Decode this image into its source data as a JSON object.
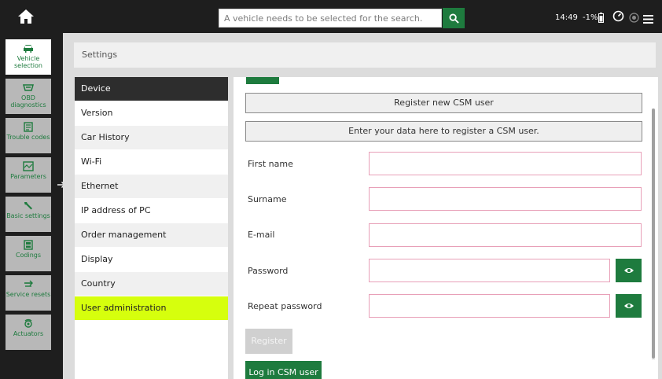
{
  "topbar": {
    "search_placeholder": "A vehicle needs to be selected for the search.",
    "clock": "14:49",
    "battery_percent": "-1%",
    "icons": [
      "home-icon",
      "search-icon",
      "battery-icon",
      "speedometer-icon",
      "status-circle-icon",
      "hamburger-menu-icon"
    ]
  },
  "sidebar": {
    "items": [
      {
        "label": "Vehicle selection",
        "icon": "car-icon",
        "active": true
      },
      {
        "label": "OBD diagnostics",
        "icon": "obd-connector-icon",
        "active": false
      },
      {
        "label": "Trouble codes",
        "icon": "trouble-codes-icon",
        "active": false
      },
      {
        "label": "Parameters",
        "icon": "parameters-icon",
        "active": false
      },
      {
        "label": "Basic settings",
        "icon": "wrench-icon",
        "active": false
      },
      {
        "label": "Codings",
        "icon": "codings-icon",
        "active": false
      },
      {
        "label": "Service resets",
        "icon": "service-reset-icon",
        "active": false
      },
      {
        "label": "Actuators",
        "icon": "actuators-icon",
        "active": false
      }
    ],
    "expand_arrow": "→"
  },
  "breadcrumb": {
    "title": "Settings"
  },
  "settings_menu": {
    "items": [
      {
        "label": "Device",
        "state": "dark"
      },
      {
        "label": "Version",
        "state": "normal"
      },
      {
        "label": "Car History",
        "state": "alt"
      },
      {
        "label": "Wi-Fi",
        "state": "normal"
      },
      {
        "label": "Ethernet",
        "state": "alt"
      },
      {
        "label": "IP address of PC",
        "state": "normal"
      },
      {
        "label": "Order management",
        "state": "alt"
      },
      {
        "label": "Display",
        "state": "normal"
      },
      {
        "label": "Country",
        "state": "alt"
      },
      {
        "label": "User administration",
        "state": "selected"
      }
    ]
  },
  "form": {
    "register_new_label": "Register new CSM user",
    "info_label": "Enter your data here to register a CSM user.",
    "fields": {
      "first_name": {
        "label": "First name",
        "value": ""
      },
      "surname": {
        "label": "Surname",
        "value": ""
      },
      "email": {
        "label": "E-mail",
        "value": ""
      },
      "password": {
        "label": "Password",
        "value": ""
      },
      "repeat_password": {
        "label": "Repeat password",
        "value": ""
      }
    },
    "register_button": "Register",
    "login_button": "Log in CSM user"
  },
  "colors": {
    "accent_green": "#1e7b3e",
    "selected_lime": "#d6ff0d",
    "dark_bar": "#1e1e1e",
    "input_border_pink": "#e8a0b8"
  }
}
